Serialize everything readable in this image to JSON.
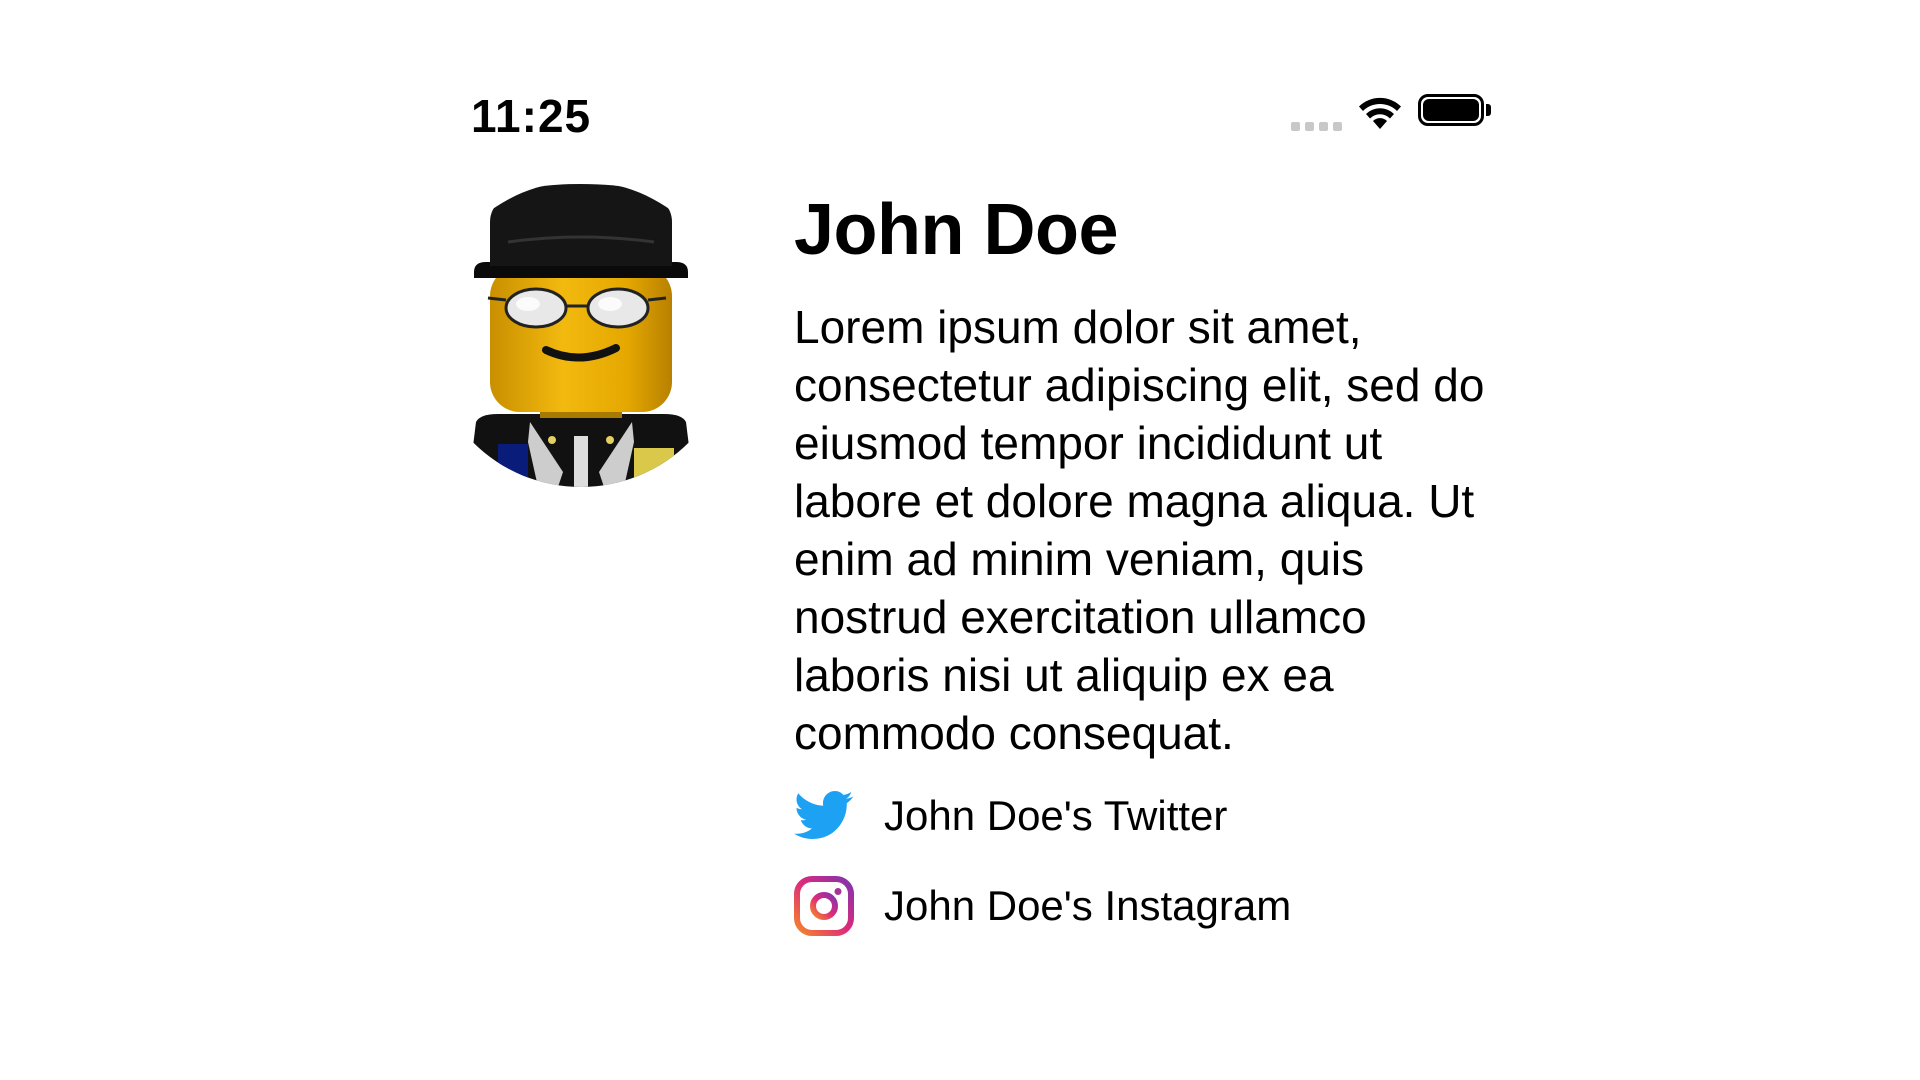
{
  "status_bar": {
    "time": "11:25",
    "icons": [
      "signal-dots-icon",
      "wifi-icon",
      "battery-icon"
    ]
  },
  "profile": {
    "avatar_icon": "lego-minifigure-avatar",
    "name": "John Doe",
    "bio": "Lorem ipsum dolor sit amet, consectetur adipiscing elit, sed do eiusmod tempor incididunt ut labore et dolore magna aliqua. Ut enim ad minim veniam, quis nostrud exercitation ullamco laboris nisi ut aliquip ex ea commodo consequat.",
    "links": [
      {
        "icon": "twitter-icon",
        "label": "John Doe's Twitter"
      },
      {
        "icon": "instagram-icon",
        "label": "John Doe's Instagram"
      }
    ]
  },
  "colors": {
    "twitter_blue": "#1DA1F2",
    "instagram_gradient": [
      "#F58529",
      "#DD2A7B",
      "#8134AF"
    ],
    "text": "#000000",
    "background": "#FFFFFF"
  }
}
